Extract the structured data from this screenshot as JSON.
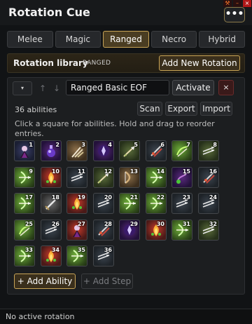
{
  "window": {
    "title": "Rotation Cue",
    "more_label": "•••"
  },
  "tabs": [
    {
      "label": "Melee",
      "active": false
    },
    {
      "label": "Magic",
      "active": false
    },
    {
      "label": "Ranged",
      "active": true
    },
    {
      "label": "Necro",
      "active": false
    },
    {
      "label": "Hybrid",
      "active": false
    }
  ],
  "library": {
    "title": "Rotation library",
    "tag": "RANGED",
    "new_button": "Add New Rotation"
  },
  "rotation": {
    "name": "Ranged Basic EOF",
    "activate_label": "Activate",
    "delete_label": "×",
    "count_label": "36 abilities",
    "scan_label": "Scan",
    "export_label": "Export",
    "import_label": "Import",
    "help_text": "Click a square for abilities. Hold and drag to reorder entries."
  },
  "abilities": [
    {
      "num": "1",
      "icon": "dark-figure-icon",
      "theme": "b"
    },
    {
      "num": "2",
      "icon": "potion-icon",
      "theme": "f"
    },
    {
      "num": "3",
      "icon": "claw-icon",
      "theme": "c"
    },
    {
      "num": "4",
      "icon": "void-orb-icon",
      "theme": "f"
    },
    {
      "num": "5",
      "icon": "arrow-icon",
      "theme": "e"
    },
    {
      "num": "6",
      "icon": "bolt-icon",
      "theme": "g"
    },
    {
      "num": "7",
      "icon": "leaf-arrow-icon",
      "theme": "a"
    },
    {
      "num": "8",
      "icon": "arrows-icon",
      "theme": "e"
    },
    {
      "num": "9",
      "icon": "bow-shot-icon",
      "theme": "a"
    },
    {
      "num": "10",
      "icon": "fire-blast-icon",
      "theme": "d"
    },
    {
      "num": "11",
      "icon": "arrows-icon",
      "theme": "g"
    },
    {
      "num": "12",
      "icon": "arrow-icon",
      "theme": "e"
    },
    {
      "num": "13",
      "icon": "bow-icon",
      "theme": "c"
    },
    {
      "num": "14",
      "icon": "bow-shot-icon",
      "theme": "a"
    },
    {
      "num": "15",
      "icon": "grapple-icon",
      "theme": "f"
    },
    {
      "num": "16",
      "icon": "bolt-icon",
      "theme": "g"
    },
    {
      "num": "17",
      "icon": "bow-shot-icon",
      "theme": "a"
    },
    {
      "num": "18",
      "icon": "sword-icon",
      "theme": "h"
    },
    {
      "num": "19",
      "icon": "fire-blast-icon",
      "theme": "d"
    },
    {
      "num": "20",
      "icon": "arrows-icon",
      "theme": "g"
    },
    {
      "num": "21",
      "icon": "bow-shot-icon",
      "theme": "a"
    },
    {
      "num": "22",
      "icon": "bow-shot-icon",
      "theme": "a"
    },
    {
      "num": "23",
      "icon": "arrows-icon",
      "theme": "g"
    },
    {
      "num": "24",
      "icon": "arrows-icon",
      "theme": "g"
    },
    {
      "num": "25",
      "icon": "leaf-arrow-icon",
      "theme": "a"
    },
    {
      "num": "26",
      "icon": "arrows-icon",
      "theme": "g"
    },
    {
      "num": "27",
      "icon": "dark-figure-icon",
      "theme": "d"
    },
    {
      "num": "28",
      "icon": "bolt-icon",
      "theme": "g"
    },
    {
      "num": "29",
      "icon": "void-orb-icon",
      "theme": "f"
    },
    {
      "num": "30",
      "icon": "fire-blast-icon",
      "theme": "d"
    },
    {
      "num": "31",
      "icon": "bow-shot-icon",
      "theme": "a"
    },
    {
      "num": "32",
      "icon": "arrows-icon",
      "theme": "e"
    },
    {
      "num": "33",
      "icon": "bow-shot-icon",
      "theme": "a"
    },
    {
      "num": "34",
      "icon": "fire-blast-icon",
      "theme": "d"
    },
    {
      "num": "35",
      "icon": "bow-shot-icon",
      "theme": "a"
    },
    {
      "num": "36",
      "icon": "arrows-icon",
      "theme": "g"
    }
  ],
  "actions": {
    "add_ability": "+ Add Ability",
    "add_step": "+ Add Step"
  },
  "status": {
    "text": "No active rotation"
  },
  "colors": {
    "accent_gold": "#c8a456",
    "panel": "#1c1e20",
    "background": "#111315"
  }
}
